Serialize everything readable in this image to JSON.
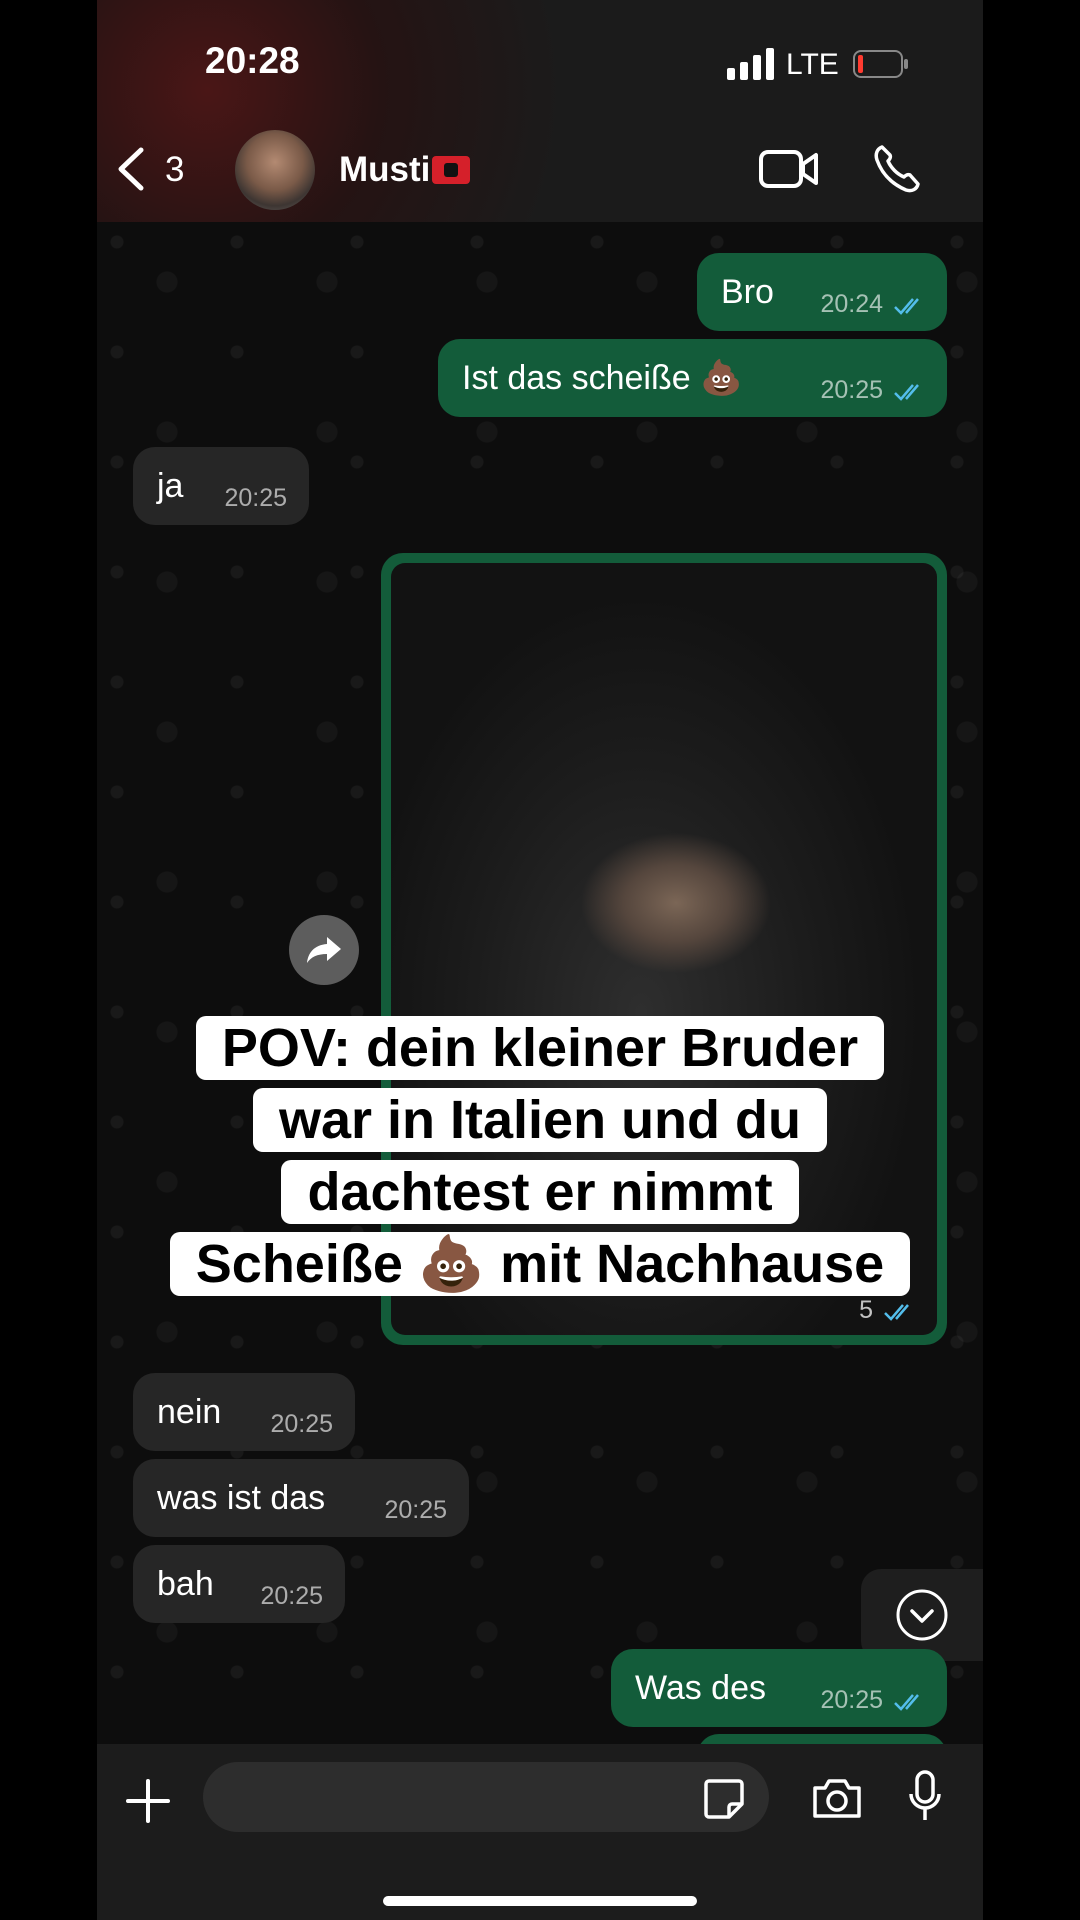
{
  "status_bar": {
    "time": "20:28",
    "network": "LTE"
  },
  "header": {
    "back_count": "3",
    "contact_name": "Musti"
  },
  "messages": [
    {
      "dir": "out",
      "text": "Bro",
      "time": "20:24"
    },
    {
      "dir": "out",
      "text": "Ist das scheiße 💩",
      "time": "20:25"
    },
    {
      "dir": "in",
      "text": "ja",
      "time": "20:25"
    },
    {
      "dir": "in",
      "text": "nein",
      "time": "20:25"
    },
    {
      "dir": "in",
      "text": "was ist das",
      "time": "20:25"
    },
    {
      "dir": "in",
      "text": "bah",
      "time": "20:25"
    },
    {
      "dir": "out",
      "text": "Was des",
      "time": "20:25"
    }
  ],
  "image_message": {
    "time_fragment": "5"
  },
  "caption": {
    "lines": [
      "POV: dein kleiner Bruder",
      "war in Italien und du",
      "dachtest er nimmt",
      "Scheiße 💩 mit Nachhause"
    ]
  },
  "input": {
    "placeholder": ""
  },
  "colors": {
    "outgoing": "#135c3a",
    "incoming": "#262626",
    "ticks": "#53bdeb"
  },
  "icons": [
    "signal-icon",
    "battery-icon",
    "back-chevron-icon",
    "video-call-icon",
    "voice-call-icon",
    "forward-icon",
    "scroll-down-icon",
    "plus-icon",
    "sticker-icon",
    "camera-icon",
    "mic-icon"
  ]
}
